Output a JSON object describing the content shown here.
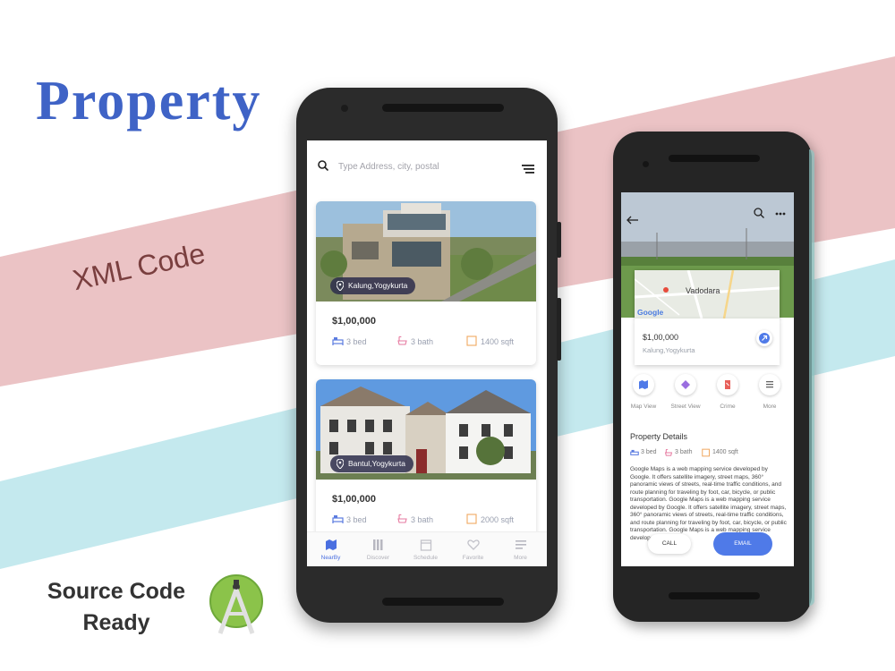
{
  "promo": {
    "title": "Property",
    "subtitle": "XML Code",
    "footer_line1": "Source Code",
    "footer_line2": "Ready"
  },
  "colors": {
    "accent": "#3f63c6",
    "stripe_pink": "#ebc3c5",
    "stripe_blue": "#c4e9ee",
    "app_blue": "#4f7ae8"
  },
  "listing_screen": {
    "search": {
      "placeholder": "Type Address, city, postal",
      "icon": "search-icon",
      "menu_icon": "filter-menu-icon"
    },
    "cards": [
      {
        "location": "Kalung,Yogykurta",
        "price": "$1,00,000",
        "bed": "3 bed",
        "bath": "3 bath",
        "area": "1400 sqft"
      },
      {
        "location": "Bantul,Yogykurta",
        "price": "$1,00,000",
        "bed": "3 bed",
        "bath": "3 bath",
        "area": "2000 sqft"
      }
    ],
    "tabs": [
      {
        "label": "NearBy",
        "icon": "map-icon",
        "active": true
      },
      {
        "label": "Discover",
        "icon": "grid-icon",
        "active": false
      },
      {
        "label": "Schedule",
        "icon": "calendar-icon",
        "active": false
      },
      {
        "label": "Favorite",
        "icon": "heart-icon",
        "active": false
      },
      {
        "label": "More",
        "icon": "more-lines-icon",
        "active": false
      }
    ]
  },
  "detail_screen": {
    "map_city": "Vadodara",
    "map_brand": "Google",
    "price": "$1,00,000",
    "address": "Kalung,Yogykurta",
    "actions": [
      {
        "label": "Map View",
        "icon": "map-icon"
      },
      {
        "label": "Street View",
        "icon": "street-view-icon"
      },
      {
        "label": "Crime",
        "icon": "crime-icon"
      },
      {
        "label": "More",
        "icon": "more-lines-icon"
      }
    ],
    "section_title": "Property Details",
    "bed": "3 bed",
    "bath": "3 bath",
    "area": "1400 sqft",
    "description": "Google Maps is a web mapping service developed by Google. It offers satellite imagery, street maps, 360° panoramic views of streets, real-time traffic conditions, and route planning for traveling by foot, car, bicycle, or public transportation. Google Maps is a web mapping service developed by Google. It offers satellite imagery, street maps, 360° panoramic views of streets, real-time traffic conditions, and route planning for traveling by foot, car, bicycle, or public transportation. Google Maps is a web mapping service developed by Google.",
    "call_label": "CALL",
    "email_label": "EMAIL"
  }
}
